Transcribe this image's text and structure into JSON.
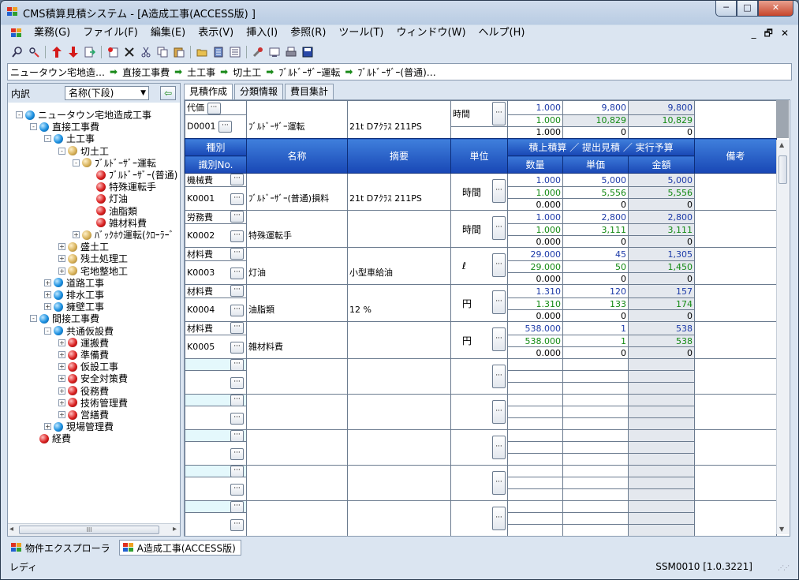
{
  "window": {
    "title": "CMS積算見積システム - [A造成工事(ACCESS版) ]",
    "min": "─",
    "max": "□",
    "close": "✕"
  },
  "menu": [
    "業務(G)",
    "ファイル(F)",
    "編集(E)",
    "表示(V)",
    "挿入(I)",
    "参照(R)",
    "ツール(T)",
    "ウィンドウ(W)",
    "ヘルプ(H)"
  ],
  "mdi": {
    "min": "_",
    "restore": "🗗",
    "close": "✕"
  },
  "breadcrumb": [
    "ニュータウン宅地造…",
    "直接工事費",
    "土工事",
    "切土工",
    "ﾌﾞﾙﾄﾞｰｻﾞｰ運転",
    "ﾌﾞﾙﾄﾞｰｻﾞｰ(普通)…"
  ],
  "left": {
    "label": "内訳",
    "select": "名称(下段)"
  },
  "tree": [
    {
      "d": 0,
      "pm": "−",
      "ic": "blue",
      "t": "ニュータウン宅地造成工事"
    },
    {
      "d": 1,
      "pm": "−",
      "ic": "blue",
      "t": "直接工事費"
    },
    {
      "d": 2,
      "pm": "−",
      "ic": "blue",
      "t": "土工事"
    },
    {
      "d": 3,
      "pm": "−",
      "ic": "tan",
      "t": "切土工"
    },
    {
      "d": 4,
      "pm": "−",
      "ic": "tan",
      "t": "ﾌﾞﾙﾄﾞｰｻﾞｰ運転"
    },
    {
      "d": 5,
      "pm": "",
      "ic": "red",
      "t": "ﾌﾞﾙﾄﾞｰｻﾞｰ(普通)"
    },
    {
      "d": 5,
      "pm": "",
      "ic": "red",
      "t": "特殊運転手"
    },
    {
      "d": 5,
      "pm": "",
      "ic": "red",
      "t": "灯油"
    },
    {
      "d": 5,
      "pm": "",
      "ic": "red",
      "t": "油脂類"
    },
    {
      "d": 5,
      "pm": "",
      "ic": "red",
      "t": "雑材料費"
    },
    {
      "d": 4,
      "pm": "+",
      "ic": "tan",
      "t": "ﾊﾞｯｸﾎｳ運転(ｸﾛｰﾗｰﾞ"
    },
    {
      "d": 3,
      "pm": "+",
      "ic": "tan",
      "t": "盛土工"
    },
    {
      "d": 3,
      "pm": "+",
      "ic": "tan",
      "t": "残土処理工"
    },
    {
      "d": 3,
      "pm": "+",
      "ic": "tan",
      "t": "宅地整地工"
    },
    {
      "d": 2,
      "pm": "+",
      "ic": "blue",
      "t": "道路工事"
    },
    {
      "d": 2,
      "pm": "+",
      "ic": "blue",
      "t": "排水工事"
    },
    {
      "d": 2,
      "pm": "+",
      "ic": "blue",
      "t": "擁壁工事"
    },
    {
      "d": 1,
      "pm": "−",
      "ic": "blue",
      "t": "間接工事費"
    },
    {
      "d": 2,
      "pm": "−",
      "ic": "blue",
      "t": "共通仮設費"
    },
    {
      "d": 3,
      "pm": "+",
      "ic": "red",
      "t": "運搬費"
    },
    {
      "d": 3,
      "pm": "+",
      "ic": "red",
      "t": "準備費"
    },
    {
      "d": 3,
      "pm": "+",
      "ic": "red",
      "t": "仮設工事"
    },
    {
      "d": 3,
      "pm": "+",
      "ic": "red",
      "t": "安全対策費"
    },
    {
      "d": 3,
      "pm": "+",
      "ic": "red",
      "t": "役務費"
    },
    {
      "d": 3,
      "pm": "+",
      "ic": "red",
      "t": "技術管理費"
    },
    {
      "d": 3,
      "pm": "+",
      "ic": "red",
      "t": "営繕費"
    },
    {
      "d": 2,
      "pm": "+",
      "ic": "blue",
      "t": "現場管理費"
    },
    {
      "d": 1,
      "pm": "",
      "ic": "red",
      "t": "経費"
    }
  ],
  "tabs": [
    "見積作成",
    "分類情報",
    "費目集計"
  ],
  "parent": {
    "kind": "代価",
    "id": "D0001",
    "name": "ﾌﾞﾙﾄﾞｰｻﾞｰ運転",
    "desc": "21t D7ｸﾗｽ 211PS",
    "unit": "時間",
    "q": [
      "1.000",
      "1.000",
      "1.000"
    ],
    "p": [
      "9,800",
      "10,829",
      "0"
    ],
    "a": [
      "9,800",
      "10,829",
      "0"
    ]
  },
  "header": {
    "kind": "種別",
    "id": "識別No.",
    "name": "名称",
    "desc": "摘要",
    "unit": "単位",
    "group": "積上積算 ／ 提出見積 ／ 実行予算",
    "qty": "数量",
    "price": "単価",
    "amount": "金額",
    "note": "備考"
  },
  "rows": [
    {
      "kind": "機械費",
      "id": "K0001",
      "name": "ﾌﾞﾙﾄﾞｰｻﾞｰ(普通)損料",
      "desc": "21t D7ｸﾗｽ 211PS",
      "unit": "時間",
      "q": [
        "1.000",
        "1.000",
        "0.000"
      ],
      "p": [
        "5,000",
        "5,556",
        "0"
      ],
      "a": [
        "5,000",
        "5,556",
        "0"
      ]
    },
    {
      "kind": "労務費",
      "id": "K0002",
      "name": "特殊運転手",
      "desc": "",
      "unit": "時間",
      "q": [
        "1.000",
        "1.000",
        "0.000"
      ],
      "p": [
        "2,800",
        "3,111",
        "0"
      ],
      "a": [
        "2,800",
        "3,111",
        "0"
      ]
    },
    {
      "kind": "材料費",
      "id": "K0003",
      "name": "灯油",
      "desc": "小型車給油",
      "unit": "ℓ",
      "q": [
        "29.000",
        "29.000",
        "0.000"
      ],
      "p": [
        "45",
        "50",
        "0"
      ],
      "a": [
        "1,305",
        "1,450",
        "0"
      ]
    },
    {
      "kind": "材料費",
      "id": "K0004",
      "name": "油脂類",
      "desc": "12 %",
      "unit": "円",
      "q": [
        "1.310",
        "1.310",
        "0.000"
      ],
      "p": [
        "120",
        "133",
        "0"
      ],
      "a": [
        "157",
        "174",
        "0"
      ]
    },
    {
      "kind": "材料費",
      "id": "K0005",
      "name": "雑材料費",
      "desc": "",
      "unit": "円",
      "q": [
        "538.000",
        "538.000",
        "0.000"
      ],
      "p": [
        "1",
        "1",
        "0"
      ],
      "a": [
        "538",
        "538",
        "0"
      ]
    }
  ],
  "dots": "···",
  "taskbar": [
    "物件エクスプローラ",
    "A造成工事(ACCESS版)"
  ],
  "status": {
    "left": "レディ",
    "right": "SSM0010  [1.0.3221]"
  },
  "scroll": {
    "hthumb": "III"
  }
}
